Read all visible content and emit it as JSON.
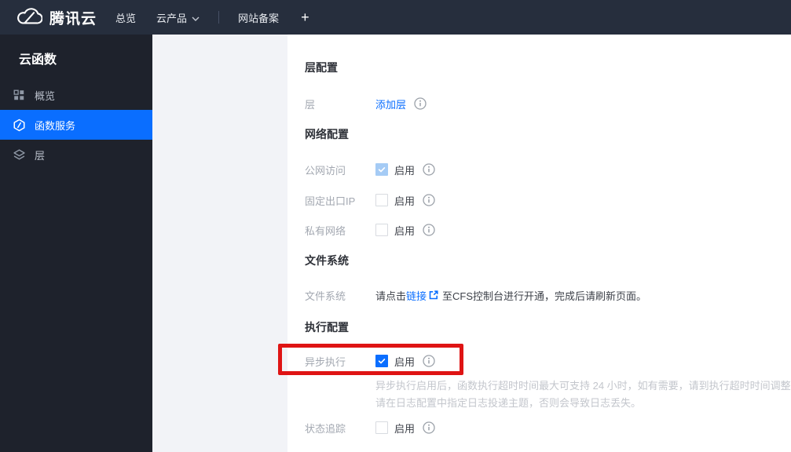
{
  "navbar": {
    "brand": "腾讯云",
    "overview": "总览",
    "cloud_products": "云产品",
    "website_record": "网站备案",
    "add": "+"
  },
  "sidebar": {
    "title": "云函数",
    "items": [
      {
        "label": "概览",
        "active": false
      },
      {
        "label": "函数服务",
        "active": true
      },
      {
        "label": "层",
        "active": false
      }
    ]
  },
  "content": {
    "layer_section": {
      "title": "层配置",
      "layer_label": "层",
      "add_layer_link": "添加层"
    },
    "network_section": {
      "title": "网络配置",
      "rows": [
        {
          "label": "公网访问",
          "enable_label": "启用",
          "state": "checked-disabled"
        },
        {
          "label": "固定出口IP",
          "enable_label": "启用",
          "state": "unchecked"
        },
        {
          "label": "私有网络",
          "enable_label": "启用",
          "state": "unchecked"
        }
      ]
    },
    "filesystem_section": {
      "title": "文件系统",
      "row_label": "文件系统",
      "text_before_link": "请点击",
      "link": "链接",
      "text_after_link": "至CFS控制台进行开通，完成后请刷新页面。"
    },
    "execution_section": {
      "title": "执行配置",
      "async_row": {
        "label": "异步执行",
        "enable_label": "启用",
        "state": "checked"
      },
      "description_line1": "异步执行启用后，函数执行超时时间最大可支持 24 小时，如有需要，请到执行超时时间调整。",
      "description_line2": "请在日志配置中指定日志投递主题，否则会导致日志丢失。",
      "trace_row": {
        "label": "状态追踪",
        "enable_label": "启用",
        "state": "unchecked"
      }
    }
  },
  "annotation": {
    "highlight_color": "#df1414",
    "target": "异步执行 启用"
  },
  "colors": {
    "accent_blue": "#0a6eff",
    "navbar_bg": "#262e3d",
    "sidebar_bg": "#1e222c",
    "content_bg": "#f2f3f7",
    "disabled_check_bg": "#a5cbf5"
  }
}
